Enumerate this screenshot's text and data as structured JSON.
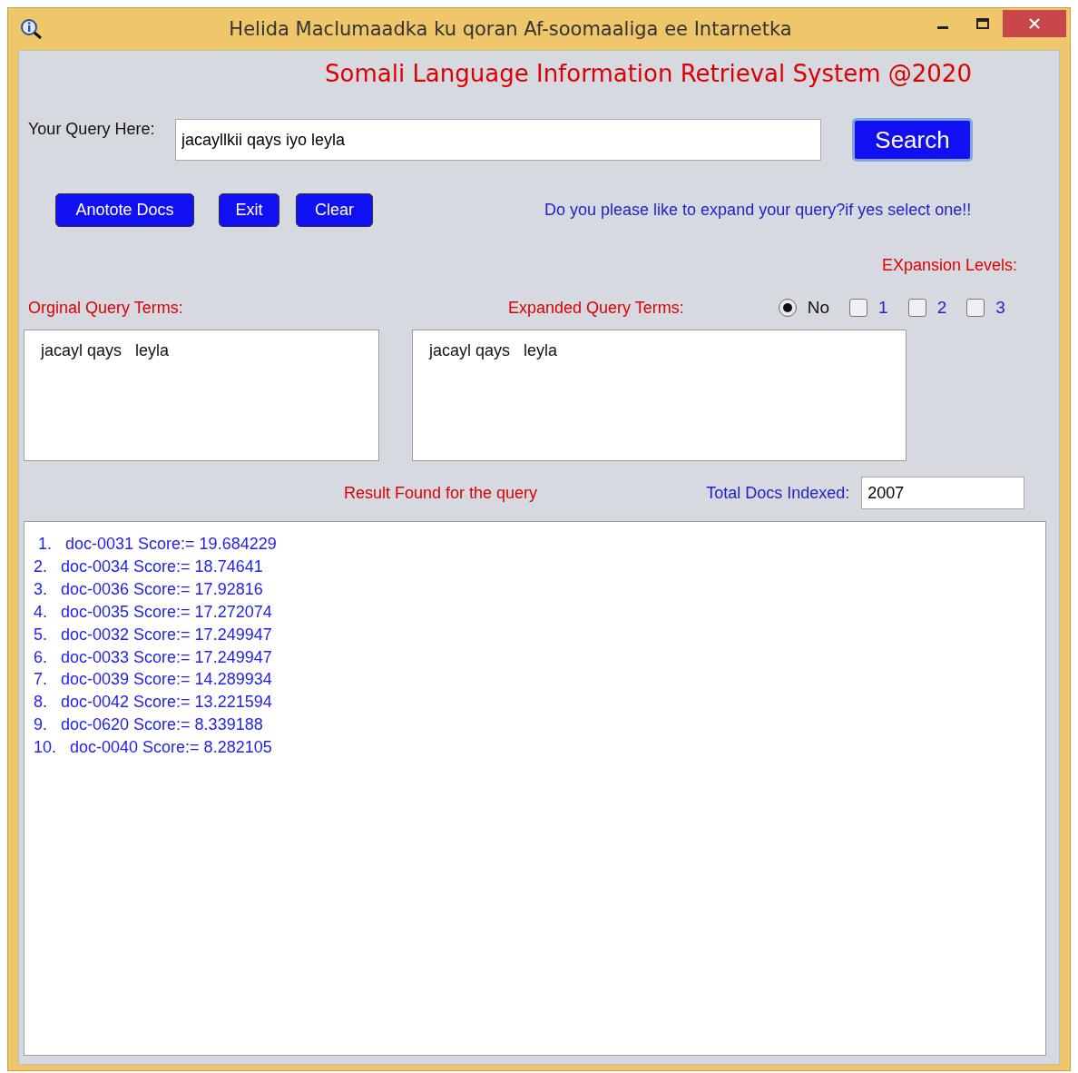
{
  "window": {
    "title": "Helida Maclumaadka ku qoran Af-soomaaliga ee Intarnetka"
  },
  "heading": "Somali Language Information Retrieval System @2020",
  "query": {
    "label": "Your Query Here:",
    "value": "jacayllkii qays iyo leyla",
    "button": "Search"
  },
  "buttons": [
    "Anotote Docs",
    "Exit",
    "Clear"
  ],
  "expand_prompt": "Do you please like to expand your query?if yes select one!!",
  "expansion_levels_label": "EXpansion Levels:",
  "original_terms": {
    "label": "Orginal Query Terms:",
    "text": "jacayl qays   leyla"
  },
  "expanded_terms": {
    "label": "Expanded Query Terms:",
    "text": "jacayl qays   leyla"
  },
  "expansion_options": [
    {
      "label": "No",
      "kind": "radio",
      "checked": true
    },
    {
      "label": "1",
      "kind": "checkbox",
      "checked": false
    },
    {
      "label": "2",
      "kind": "checkbox",
      "checked": false
    },
    {
      "label": "3",
      "kind": "checkbox",
      "checked": false
    }
  ],
  "results_label": "Result Found for the query",
  "total_docs": {
    "label": "Total Docs Indexed:",
    "value": "2007"
  },
  "results": [
    " 1.   doc-0031 Score:= 19.684229",
    "2.   doc-0034 Score:= 18.74641",
    "3.   doc-0036 Score:= 17.92816",
    "4.   doc-0035 Score:= 17.272074",
    "5.   doc-0032 Score:= 17.249947",
    "6.   doc-0033 Score:= 17.249947",
    "7.   doc-0039 Score:= 14.289934",
    "8.   doc-0042 Score:= 13.221594",
    "9.   doc-0620 Score:= 8.339188",
    "10.   doc-0040 Score:= 8.282105"
  ]
}
